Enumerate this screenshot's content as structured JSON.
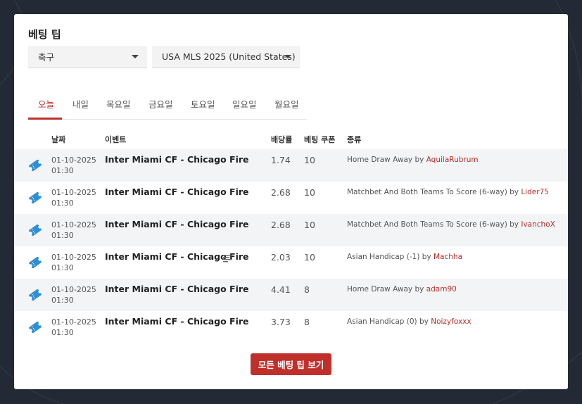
{
  "page": {
    "title": "베팅 팁"
  },
  "filters": {
    "sport": "축구",
    "league": "USA MLS 2025 (United States)"
  },
  "tabs": [
    "오늘",
    "내일",
    "목요일",
    "금요일",
    "토요일",
    "일요일",
    "월요일"
  ],
  "active_tab": "오늘",
  "table": {
    "headers": {
      "date": "날짜",
      "event": "이벤트",
      "odds": "배당률",
      "stake": "베팅 쿠폰",
      "type": "종류"
    },
    "rows": [
      {
        "date": "01-10-2025",
        "time": "01:30",
        "event": "Inter Miami CF - Chicago Fire",
        "odds": "1.74",
        "stake": "10",
        "tip": "Home Draw Away",
        "by": "by",
        "user": "AquilaRubrum"
      },
      {
        "date": "01-10-2025",
        "time": "01:30",
        "event": "Inter Miami CF - Chicago Fire",
        "odds": "2.68",
        "stake": "10",
        "tip": "Matchbet And Both Teams To Score (6-way)",
        "by": "by",
        "user": "Lider75"
      },
      {
        "date": "01-10-2025",
        "time": "01:30",
        "event": "Inter Miami CF - Chicago Fire",
        "odds": "2.68",
        "stake": "10",
        "tip": "Matchbet And Both Teams To Score (6-way)",
        "by": "by",
        "user": "IvanchoX"
      },
      {
        "date": "01-10-2025",
        "time": "01:30",
        "event": "Inter Miami CF - Chicago Fire",
        "odds": "2.03",
        "stake": "10",
        "tip": "Asian Handicap (-1)",
        "by": "by",
        "user": "Machha"
      },
      {
        "date": "01-10-2025",
        "time": "01:30",
        "event": "Inter Miami CF - Chicago Fire",
        "odds": "4.41",
        "stake": "8",
        "tip": "Home Draw Away",
        "by": "by",
        "user": "adam90"
      },
      {
        "date": "01-10-2025",
        "time": "01:30",
        "event": "Inter Miami CF - Chicago Fire",
        "odds": "3.73",
        "stake": "8",
        "tip": "Asian Handicap (0)",
        "by": "by",
        "user": "Noizyfoxxx"
      }
    ]
  },
  "button": {
    "label": "모든 베팅 팁 보기"
  },
  "colors": {
    "accent": "#c0302b",
    "background": "#232a35",
    "row_shade": "#f3f4f6",
    "ticket_icon": "#2f8fd6"
  }
}
